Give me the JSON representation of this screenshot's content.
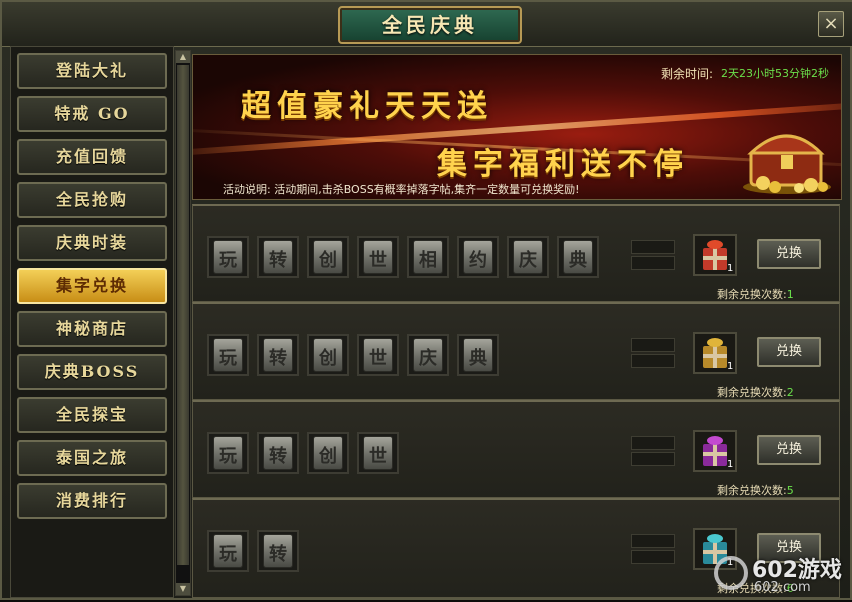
{
  "window": {
    "title": "全民庆典",
    "close_icon": "×"
  },
  "sidebar": {
    "items": [
      {
        "label": "登陆大礼"
      },
      {
        "label": "特戒 GO"
      },
      {
        "label": "充值回馈"
      },
      {
        "label": "全民抢购"
      },
      {
        "label": "庆典时装"
      },
      {
        "label": "集字兑换",
        "active": true
      },
      {
        "label": "神秘商店"
      },
      {
        "label": "庆典BOSS"
      },
      {
        "label": "全民探宝"
      },
      {
        "label": "泰国之旅"
      },
      {
        "label": "消费排行"
      }
    ]
  },
  "banner": {
    "slogan1": "超值豪礼天天送",
    "slogan2": "集字福利送不停",
    "remain_label": "剩余时间:",
    "remain_value": "2天23小时53分钟2秒",
    "desc": "活动说明:  活动期间,击杀BOSS有概率掉落字帖,集齐一定数量可兑换奖励!"
  },
  "exchange": {
    "button_label": "兑换",
    "remain_label": "剩余兑换次数:",
    "rows": [
      {
        "chars": [
          "玩",
          "转",
          "创",
          "世",
          "相",
          "约",
          "庆",
          "典"
        ],
        "qty": "1",
        "remain": "1",
        "gift_color": "#c23a2a",
        "bow_color": "#e04a2a"
      },
      {
        "chars": [
          "玩",
          "转",
          "创",
          "世",
          "庆",
          "典"
        ],
        "qty": "1",
        "remain": "2",
        "gift_color": "#b88a2a",
        "bow_color": "#e0b43a"
      },
      {
        "chars": [
          "玩",
          "转",
          "创",
          "世"
        ],
        "qty": "1",
        "remain": "5",
        "gift_color": "#8a2a9a",
        "bow_color": "#c34ad0"
      },
      {
        "chars": [
          "玩",
          "转"
        ],
        "qty": "1",
        "remain": "6",
        "gift_color": "#2a8a9a",
        "bow_color": "#4ac8d0"
      }
    ]
  },
  "watermark": {
    "brand": "602游戏",
    "url": "602.com"
  }
}
